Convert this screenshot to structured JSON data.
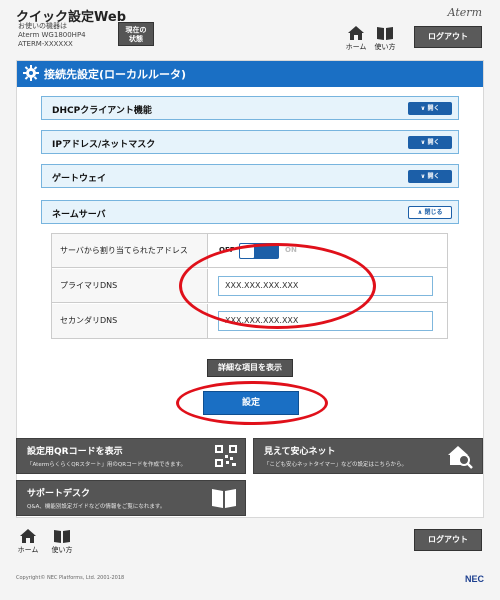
{
  "header": {
    "title": "クイック設定Web",
    "device_lines": [
      "お使いの機器は",
      "Aterm WG1800HP4",
      "ATERM-XXXXXX"
    ],
    "status_button": [
      "現在の",
      "状態"
    ],
    "brand": "Aterm",
    "home_label": "ホーム",
    "help_label": "使い方",
    "logout_label": "ログアウト"
  },
  "panel": {
    "title": "接続先設定(ローカルルータ)",
    "sections": [
      {
        "label": "DHCPクライアント機能",
        "button": "開く"
      },
      {
        "label": "IPアドレス/ネットマスク",
        "button": "開く"
      },
      {
        "label": "ゲートウェイ",
        "button": "開く"
      },
      {
        "label": "ネームサーバ",
        "button": "閉じる"
      }
    ],
    "rows": {
      "auto_label": "サーバから割り当てられたアドレス",
      "toggle_off": "OFF",
      "toggle_on": "ON",
      "primary_label": "プライマリDNS",
      "primary_value": "XXX.XXX.XXX.XXX",
      "secondary_label": "セカンダリDNS",
      "secondary_value": "XXX.XXX.XXX.XXX"
    },
    "detail_button": "詳細な項目を表示",
    "set_button": "設定"
  },
  "cards": [
    {
      "title": "設定用QRコードを表示",
      "desc": "「AtermらくらくQRスタート」用のQRコードを作成できます。",
      "icon": "qr-code-icon"
    },
    {
      "title": "見えて安心ネット",
      "desc": "「こども安心ネットタイマー」などの設定はこちらから。",
      "icon": "home-search-icon"
    },
    {
      "title": "サポートデスク",
      "desc": "Q&A、機能別設定ガイドなどの情報をご覧になれます。",
      "icon": "book-icon"
    }
  ],
  "footer": {
    "home_label": "ホーム",
    "help_label": "使い方",
    "logout_label": "ログアウト",
    "copyright": "Copyright© NEC Platforms, Ltd. 2001-2018",
    "nec": "NEC"
  },
  "colors": {
    "accent": "#1a6fc4",
    "highlight_ellipse": "#e0101a",
    "button_dark": "#555555"
  }
}
